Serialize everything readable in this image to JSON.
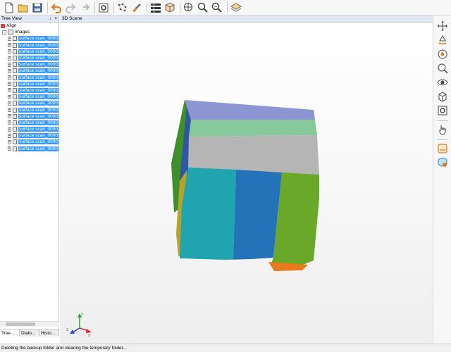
{
  "toolbar": {
    "buttons": [
      "new-file-icon",
      "open-folder-icon",
      "save-icon",
      "undo-icon",
      "redo-disabled-icon",
      "redo-icon",
      "settings-icon",
      "points-icon",
      "brush-icon",
      "grid-icon",
      "cube-icon",
      "globe-scale-icon",
      "zoom-in-icon",
      "zoom-out-icon",
      "layers-icon"
    ]
  },
  "tree_view": {
    "title": "Tree View",
    "pin_glyph": "↓",
    "close_glyph": "×",
    "root": {
      "label": "Align"
    },
    "images": {
      "label": "images"
    },
    "items": [
      "surface scan_0000",
      "surface scan_0000",
      "surface scan_0000",
      "surface scan_0000",
      "surface scan_0000",
      "surface scan_0000",
      "surface scan_0000",
      "surface scan_0000",
      "surface scan_0000",
      "surface scan_0000",
      "surface scan_0000",
      "surface scan_0000",
      "surface scan_0000",
      "surface scan_0000",
      "surface scan_0000",
      "surface scan_0000",
      "surface scan_0000",
      "surface scan_0000"
    ],
    "tabs": [
      "Tree ...",
      "Dialo...",
      "Histo..."
    ]
  },
  "scene": {
    "title": "3D Scene",
    "axis_labels": {
      "y": "y",
      "x": "x",
      "z": "z"
    },
    "colors": {
      "top_purple": "#8d95d3",
      "top_green": "#87c99b",
      "top_gray": "#b5b5b5",
      "front_teal": "#20a4b0",
      "front_blue": "#2472b8",
      "front_green": "#6aa829",
      "left_blue": "#2f58a0",
      "left_green": "#3f8f2a",
      "orange": "#e77a1a"
    }
  },
  "right_toolbar": {
    "buttons": [
      "pan-icon",
      "rotate-icon",
      "fit-view-icon",
      "zoom-region-icon",
      "visibility-icon",
      "box-view-icon",
      "camera-settings-icon",
      "hand-select-icon",
      "render-mode-icon",
      "surface-paint-icon"
    ]
  },
  "status": {
    "text": "Deleting the backup folder and clearing the temporary folder..."
  }
}
